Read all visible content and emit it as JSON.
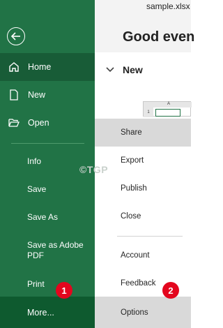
{
  "file": {
    "name": "sample.xlsx"
  },
  "greeting": "Good even",
  "new_section": {
    "label": "New"
  },
  "thumbnail": {
    "col": "A",
    "row": "1"
  },
  "sidebar": {
    "nav": [
      {
        "label": "Home",
        "icon": "home-icon"
      },
      {
        "label": "New",
        "icon": "new-file-icon"
      },
      {
        "label": "Open",
        "icon": "folder-open-icon"
      }
    ],
    "items": [
      {
        "label": "Info"
      },
      {
        "label": "Save"
      },
      {
        "label": "Save As"
      },
      {
        "label": "Save as Adobe PDF"
      },
      {
        "label": "Print"
      },
      {
        "label": "More..."
      }
    ]
  },
  "more_menu": {
    "items": [
      {
        "label": "Share"
      },
      {
        "label": "Export"
      },
      {
        "label": "Publish"
      },
      {
        "label": "Close"
      },
      {
        "label": "Account"
      },
      {
        "label": "Feedback"
      },
      {
        "label": "Options"
      }
    ]
  },
  "badges": [
    "1",
    "2"
  ],
  "watermark": "©TGP",
  "colors": {
    "accent": "#217346",
    "badge": "#e3061e"
  }
}
